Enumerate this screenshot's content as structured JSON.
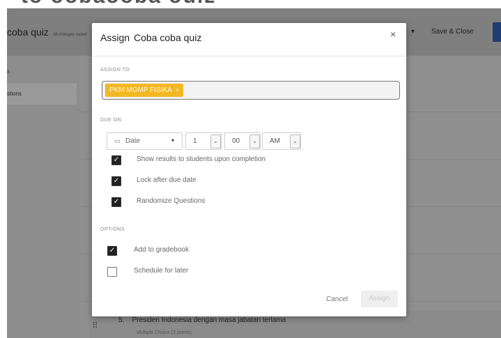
{
  "page_heading_partial": "to oobaooba ouiz",
  "background": {
    "quiz_title": "coba quiz",
    "save_status": "All changes saved",
    "header_right_icon": "chevron-down-icon",
    "save_close_label": "Save & Close",
    "sidebar_short": "s",
    "sidebar_item": "stions",
    "question": {
      "number": "5.",
      "text": "Presiden Indonesia dengan masa jabatan terlama",
      "meta": "Multiple Choice (2 points)"
    }
  },
  "modal": {
    "title_prefix": "Assign",
    "title_name": "Coba coba quiz",
    "close_glyph": "×",
    "assign_to_label": "ASSIGN TO",
    "assign_to_chip": "PKM MGMP FISIKA",
    "chip_remove_glyph": "×",
    "due_on_label": "DUE ON",
    "date_placeholder": "Date",
    "hour": "1",
    "minute": "00",
    "ampm": "AM",
    "settings": [
      {
        "label": "Show results to students upon completion",
        "checked": true
      },
      {
        "label": "Lock after due date",
        "checked": true
      },
      {
        "label": "Randomize Questions",
        "checked": true
      }
    ],
    "options_label": "OPTIONS",
    "options": [
      {
        "label": "Add to gradebook",
        "checked": true
      },
      {
        "label": "Schedule for later",
        "checked": false
      }
    ],
    "cancel_label": "Cancel",
    "assign_label": "Assign"
  },
  "colors": {
    "chip_bg": "#f2b824",
    "overlay": "#8d8d8d",
    "primary_dark": "#203d73"
  }
}
